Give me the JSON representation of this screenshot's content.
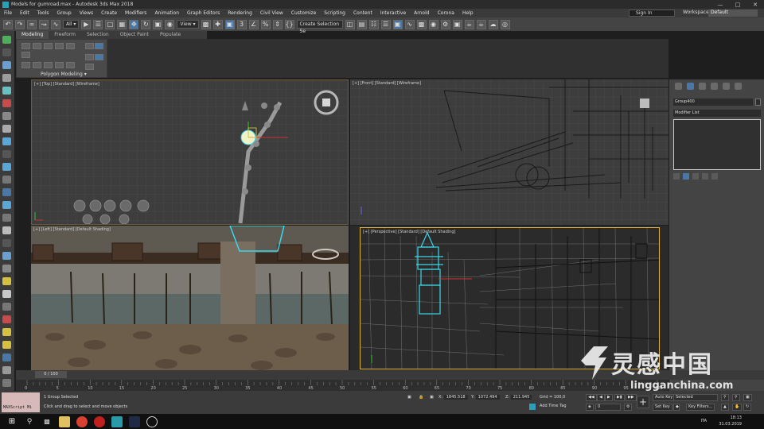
{
  "window": {
    "title": "Models for gumroad.max - Autodesk 3ds Max 2018",
    "controls": [
      "—",
      "□",
      "✕"
    ]
  },
  "menu": {
    "items": [
      "File",
      "Edit",
      "Tools",
      "Group",
      "Views",
      "Create",
      "Modifiers",
      "Animation",
      "Graph Editors",
      "Rendering",
      "Civil View",
      "Customize",
      "Scripting",
      "Content",
      "Interactive",
      "Arnold",
      "Corona",
      "Help"
    ],
    "sign_in": "Sign In",
    "workspaces_label": "Workspaces:",
    "workspace_value": "Default"
  },
  "toolbar": {
    "filter_value": "All",
    "view_value": "View",
    "selection_set_placeholder": "Create Selection Se"
  },
  "ribbon": {
    "tabs": [
      "Modeling",
      "Freeform",
      "Selection",
      "Object Paint",
      "Populate"
    ],
    "active_tab": "Modeling",
    "panel_label": "Polygon Modeling"
  },
  "viewports": {
    "top": "[+] [Top] [Standard] [Wireframe]",
    "front": "[+] [Front] [Standard] [Wireframe]",
    "left": "[+] [Left] [Standard] [Default Shading]",
    "perspective": "[+] [Perspective] [Standard] [Default Shading]"
  },
  "command_panel": {
    "object_name": "Group400",
    "modifier_list": "Modifier List"
  },
  "timeline": {
    "frame_display": "0 / 100",
    "ticks": [
      "0",
      "5",
      "10",
      "15",
      "20",
      "25",
      "30",
      "35",
      "40",
      "45",
      "50",
      "55",
      "60",
      "65",
      "70",
      "75",
      "80",
      "85",
      "90",
      "95",
      "100"
    ]
  },
  "status": {
    "maxscript_label": "MAXScript Mi",
    "selection_info": "1 Group Selected",
    "prompt": "Click and drag to select and move objects",
    "x_label": "X:",
    "x_value": "1845.518",
    "y_label": "Y:",
    "y_value": "1072.494",
    "z_label": "Z:",
    "z_value": "211.945",
    "grid_label": "Grid = 100,0",
    "add_time_tag": "Add Time Tag",
    "auto_key": "Auto Key",
    "selected_value": "Selected",
    "set_key": "Set Key",
    "key_filters": "Key Filters...",
    "frame_field": "0"
  },
  "taskbar": {
    "language": "ITA",
    "time": "18:13",
    "date": "31.03.2019"
  },
  "watermark": {
    "text": "灵感中国",
    "url": "lingganchina.com"
  },
  "colors": {
    "accent_active": "#4a78a6",
    "viewport_active_border": "#e0b43c",
    "selection_cyan": "#39d8e8"
  }
}
